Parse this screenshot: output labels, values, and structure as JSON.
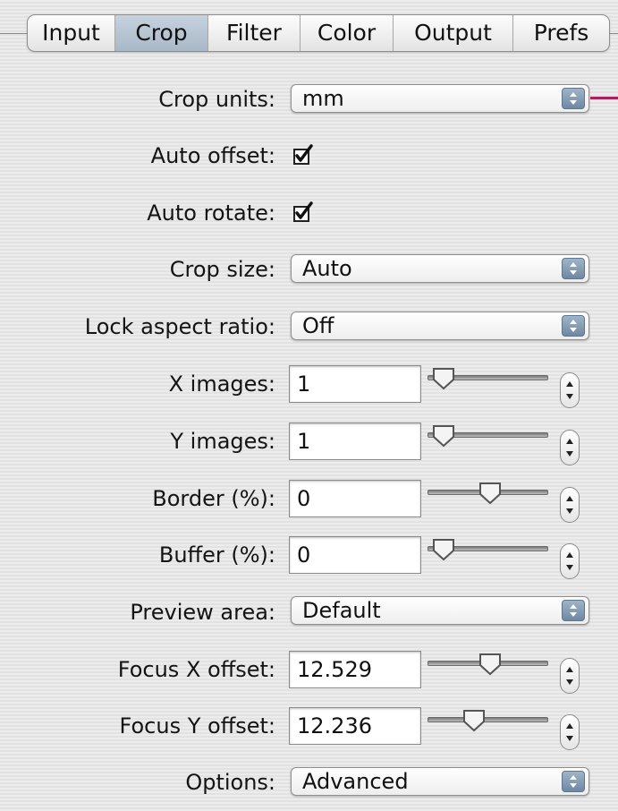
{
  "tabs": [
    {
      "label": "Input",
      "active": false
    },
    {
      "label": "Crop",
      "active": true
    },
    {
      "label": "Filter",
      "active": false
    },
    {
      "label": "Color",
      "active": false
    },
    {
      "label": "Output",
      "active": false
    },
    {
      "label": "Prefs",
      "active": false
    }
  ],
  "crop_units": {
    "label": "Crop units:",
    "value": "mm"
  },
  "auto_offset": {
    "label": "Auto offset:",
    "checked": true
  },
  "auto_rotate": {
    "label": "Auto rotate:",
    "checked": true
  },
  "crop_size": {
    "label": "Crop size:",
    "value": "Auto"
  },
  "lock_aspect_ratio": {
    "label": "Lock aspect ratio:",
    "value": "Off"
  },
  "x_images": {
    "label": "X images:",
    "value": "1",
    "slider_level": 0.05
  },
  "y_images": {
    "label": "Y images:",
    "value": "1",
    "slider_level": 0.05
  },
  "border": {
    "label": "Border (%):",
    "value": "0",
    "slider_level": 0.52
  },
  "buffer": {
    "label": "Buffer (%):",
    "value": "0",
    "slider_level": 0.05
  },
  "preview_area": {
    "label": "Preview area:",
    "value": "Default"
  },
  "focus_x_offset": {
    "label": "Focus X offset:",
    "value": "12.529",
    "slider_level": 0.52
  },
  "focus_y_offset": {
    "label": "Focus Y offset:",
    "value": "12.236",
    "slider_level": 0.36
  },
  "options": {
    "label": "Options:",
    "value": "Advanced"
  },
  "colors": {
    "accent_line": "#a8215a",
    "active_tab": "#b4c2d2"
  }
}
